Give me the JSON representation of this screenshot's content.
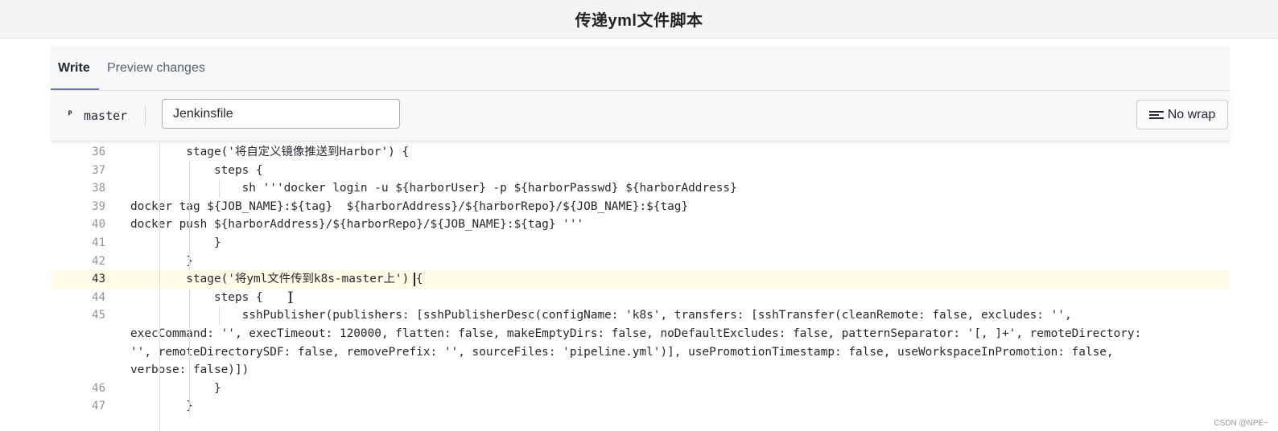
{
  "page": {
    "title": "传递yml文件脚本",
    "watermark": "CSDN @NPE~"
  },
  "tabs": [
    {
      "label": "Write",
      "active": true
    },
    {
      "label": "Preview changes",
      "active": false
    }
  ],
  "toolbar": {
    "branch_icon": "git-branch-icon",
    "branch": "master",
    "filename": "Jenkinsfile",
    "wrap_label": "No wrap",
    "wrap_icon": "wrap-lines-icon"
  },
  "editor": {
    "active_line": 43,
    "lines": [
      {
        "num": "36",
        "text": "        stage('将自定义镜像推送到Harbor') {"
      },
      {
        "num": "37",
        "text": "            steps {"
      },
      {
        "num": "38",
        "text": "                sh '''docker login -u ${harborUser} -p ${harborPasswd} ${harborAddress}"
      },
      {
        "num": "39",
        "text": "docker tag ${JOB_NAME}:${tag}  ${harborAddress}/${harborRepo}/${JOB_NAME}:${tag}"
      },
      {
        "num": "40",
        "text": "docker push ${harborAddress}/${harborRepo}/${JOB_NAME}:${tag} '''"
      },
      {
        "num": "41",
        "text": "            }"
      },
      {
        "num": "42",
        "text": "        }"
      },
      {
        "num": "43",
        "text": "        stage('将yml文件传到k8s-master上') {"
      },
      {
        "num": "44",
        "text": "            steps {"
      },
      {
        "num": "45",
        "text": "                sshPublisher(publishers: [sshPublisherDesc(configName: 'k8s', transfers: [sshTransfer(cleanRemote: false, excludes: '',"
      },
      {
        "num": "",
        "text": "execCommand: '', execTimeout: 120000, flatten: false, makeEmptyDirs: false, noDefaultExcludes: false, patternSeparator: '[, ]+', remoteDirectory:"
      },
      {
        "num": "",
        "text": "'', remoteDirectorySDF: false, removePrefix: '', sourceFiles: 'pipeline.yml')], usePromotionTimestamp: false, useWorkspaceInPromotion: false,"
      },
      {
        "num": "",
        "text": "verbose: false)])"
      },
      {
        "num": "46",
        "text": "            }"
      },
      {
        "num": "47",
        "text": "        }"
      }
    ]
  }
}
